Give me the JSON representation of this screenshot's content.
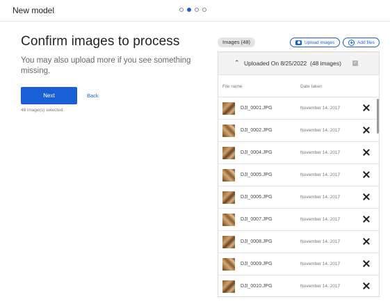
{
  "header": {
    "title": "New model",
    "steps": [
      {
        "active": false
      },
      {
        "active": true
      },
      {
        "active": false
      },
      {
        "active": false
      }
    ]
  },
  "main": {
    "title": "Confirm images to process",
    "subtitle": "You may also upload more if you see something missing.",
    "next_label": "Next",
    "back_label": "Back",
    "selected_text": "48 image(s) selected."
  },
  "toolbar": {
    "images_badge": "Images (48)",
    "upload_label": "Upload images",
    "add_files_label": "Add files"
  },
  "group": {
    "title": "Uploaded On 8/25/2022",
    "count": "(48 images)"
  },
  "columns": {
    "file_name": "File name",
    "date_taken": "Date taken"
  },
  "files": [
    {
      "name": "DJI_0001.JPG",
      "date": "November 14, 2017"
    },
    {
      "name": "DJI_0002.JPG",
      "date": "November 14, 2017"
    },
    {
      "name": "DJI_0004.JPG",
      "date": "November 14, 2017"
    },
    {
      "name": "DJI_0005.JPG",
      "date": "November 14, 2017"
    },
    {
      "name": "DJI_0006.JPG",
      "date": "November 14, 2017"
    },
    {
      "name": "DJI_0007.JPG",
      "date": "November 14, 2017"
    },
    {
      "name": "DJI_0008.JPG",
      "date": "November 14, 2017"
    },
    {
      "name": "DJI_0009.JPG",
      "date": "November 14, 2017"
    },
    {
      "name": "DJI_0010.JPG",
      "date": "November 14, 2017"
    }
  ],
  "colors": {
    "accent": "#1a5fd6",
    "badge_bg": "#e3e3e3",
    "group_header_bg": "#f3f3f3"
  }
}
